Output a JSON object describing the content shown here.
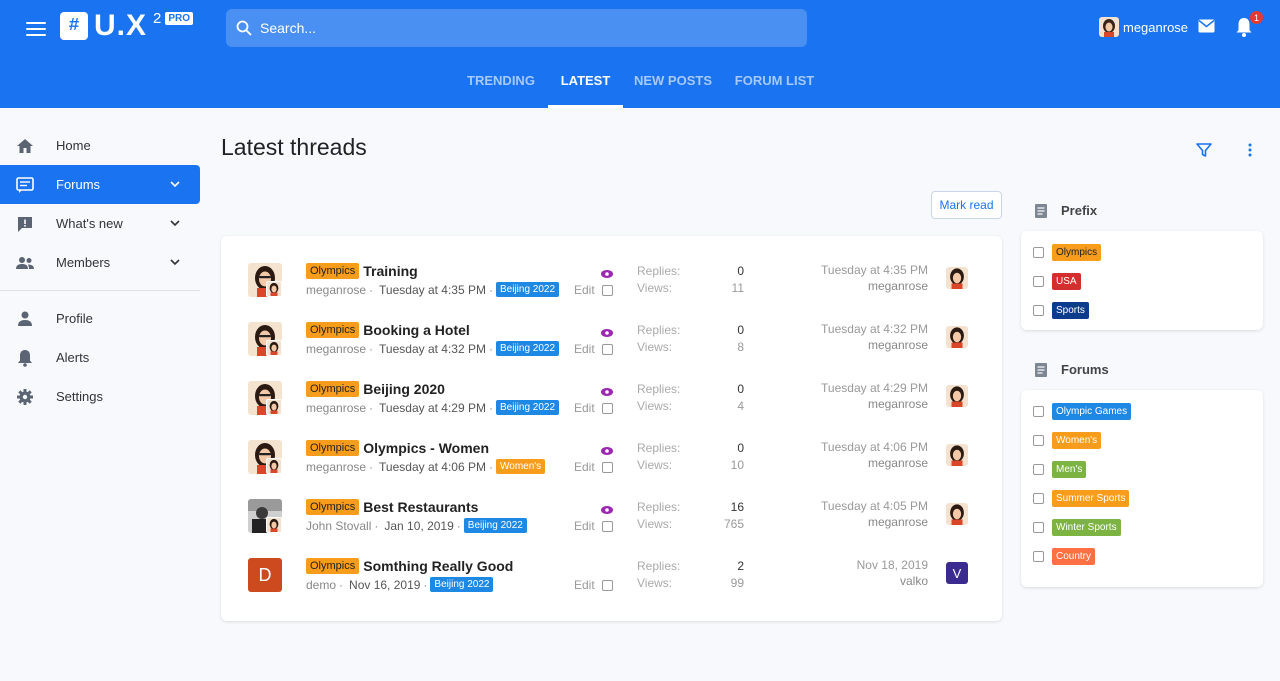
{
  "header": {
    "logo_glyph": "#",
    "logo_text": "U.X",
    "logo_sup": "2",
    "logo_pro": "PRO",
    "search_placeholder": "Search...",
    "username": "meganrose",
    "notification_count": "1"
  },
  "tabs": [
    {
      "label": "TRENDING"
    },
    {
      "label": "LATEST"
    },
    {
      "label": "NEW POSTS"
    },
    {
      "label": "FORUM LIST"
    }
  ],
  "sidebar": {
    "items": [
      {
        "label": "Home",
        "icon": "home-icon"
      },
      {
        "label": "Forums",
        "icon": "forum-icon"
      },
      {
        "label": "What's new",
        "icon": "whats-new-icon"
      },
      {
        "label": "Members",
        "icon": "members-icon"
      },
      {
        "label": "Profile",
        "icon": "profile-icon"
      },
      {
        "label": "Alerts",
        "icon": "bell-icon"
      },
      {
        "label": "Settings",
        "icon": "gear-icon"
      }
    ]
  },
  "main": {
    "title": "Latest threads",
    "mark_read": "Mark read",
    "replies_label": "Replies:",
    "views_label": "Views:",
    "edit_label": "Edit",
    "threads": [
      {
        "prefix": "Olympics",
        "title": "Training",
        "author": "meganrose",
        "date": "Tuesday at 4:35 PM",
        "tag": "Beijing 2022",
        "tag_color": "blue",
        "replies": "0",
        "views": "11",
        "last_date": "Tuesday at 4:35 PM",
        "last_user": "meganrose"
      },
      {
        "prefix": "Olympics",
        "title": "Booking a Hotel",
        "author": "meganrose",
        "date": "Tuesday at 4:32 PM",
        "tag": "Beijing 2022",
        "tag_color": "blue",
        "replies": "0",
        "views": "8",
        "last_date": "Tuesday at 4:32 PM",
        "last_user": "meganrose"
      },
      {
        "prefix": "Olympics",
        "title": "Beijing 2020",
        "author": "meganrose",
        "date": "Tuesday at 4:29 PM",
        "tag": "Beijing 2022",
        "tag_color": "blue",
        "replies": "0",
        "views": "4",
        "last_date": "Tuesday at 4:29 PM",
        "last_user": "meganrose"
      },
      {
        "prefix": "Olympics",
        "title": "Olympics - Women",
        "author": "meganrose",
        "date": "Tuesday at 4:06 PM",
        "tag": "Women's",
        "tag_color": "orange",
        "replies": "0",
        "views": "10",
        "last_date": "Tuesday at 4:06 PM",
        "last_user": "meganrose"
      },
      {
        "prefix": "Olympics",
        "title": "Best Restaurants",
        "author": "John Stovall",
        "date": "Jan 10, 2019",
        "tag": "Beijing 2022",
        "tag_color": "blue",
        "replies": "16",
        "views": "765",
        "last_date": "Tuesday at 4:05 PM",
        "last_user": "meganrose"
      },
      {
        "prefix": "Olympics",
        "title": "Somthing Really Good",
        "author": "demo",
        "date": "Nov 16, 2019",
        "tag": "Beijing 2022",
        "tag_color": "blue",
        "replies": "2",
        "views": "99",
        "last_date": "Nov 18, 2019",
        "last_user": "valko",
        "author_initial": "D",
        "last_initial": "V"
      }
    ]
  },
  "right": {
    "prefix_title": "Prefix",
    "prefix_options": [
      {
        "label": "Olympics",
        "color": "#f89c1c"
      },
      {
        "label": "USA",
        "color": "#d32f2f"
      },
      {
        "label": "Sports",
        "color": "#0d3c8c"
      }
    ],
    "forums_title": "Forums",
    "forum_options": [
      {
        "label": "Olympic Games",
        "color": "#1e88e5"
      },
      {
        "label": "Women's",
        "color": "#f89c1c"
      },
      {
        "label": "Men's",
        "color": "#7cb342"
      },
      {
        "label": "Summer Sports",
        "color": "#f89c1c"
      },
      {
        "label": "Winter Sports",
        "color": "#7cb342"
      },
      {
        "label": "Country",
        "color": "#ff7043"
      }
    ]
  }
}
